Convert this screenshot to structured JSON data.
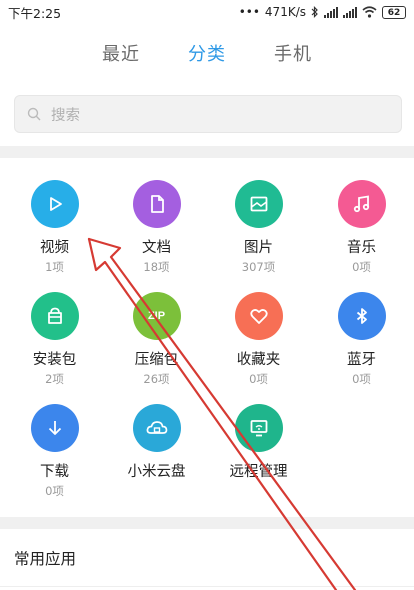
{
  "status_bar": {
    "time": "下午2:25",
    "speed": "471K/s",
    "battery": "62"
  },
  "tabs": [
    {
      "label": "最近",
      "active": false
    },
    {
      "label": "分类",
      "active": true
    },
    {
      "label": "手机",
      "active": false
    }
  ],
  "search": {
    "placeholder": "搜索"
  },
  "categories": [
    {
      "name": "视频",
      "count": "1项",
      "color": "#27aee8",
      "icon": "play-icon"
    },
    {
      "name": "文档",
      "count": "18项",
      "color": "#a45fe0",
      "icon": "document-icon"
    },
    {
      "name": "图片",
      "count": "307项",
      "color": "#20bb93",
      "icon": "image-icon"
    },
    {
      "name": "音乐",
      "count": "0项",
      "color": "#f45a93",
      "icon": "music-icon"
    },
    {
      "name": "安装包",
      "count": "2项",
      "color": "#22c08a",
      "icon": "package-icon"
    },
    {
      "name": "压缩包",
      "count": "26项",
      "color": "#7cc03a",
      "icon": "zip-icon",
      "icon_text": "ZIP"
    },
    {
      "name": "收藏夹",
      "count": "0项",
      "color": "#f76f55",
      "icon": "heart-icon"
    },
    {
      "name": "蓝牙",
      "count": "0项",
      "color": "#3c86ec",
      "icon": "bluetooth-icon"
    },
    {
      "name": "下载",
      "count": "0项",
      "color": "#3c86ec",
      "icon": "download-icon"
    },
    {
      "name": "小米云盘",
      "count": "",
      "color": "#2aa8d8",
      "icon": "cloud-drive-icon"
    },
    {
      "name": "远程管理",
      "count": "",
      "color": "#1fb58c",
      "icon": "remote-management-icon"
    }
  ],
  "common_apps_label": "常用应用",
  "annotation": {
    "color": "#d63a33",
    "shape": "red-arrow"
  }
}
